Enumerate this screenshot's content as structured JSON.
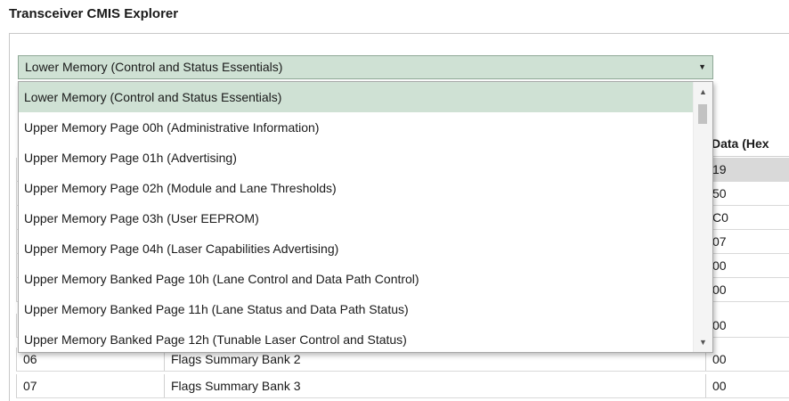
{
  "app": {
    "title": "Transceiver CMIS Explorer"
  },
  "memory_select": {
    "selected": "Lower Memory (Control and Status Essentials)",
    "options": [
      "Lower Memory (Control and Status Essentials)",
      "Upper Memory Page 00h (Administrative Information)",
      "Upper Memory Page 01h (Advertising)",
      "Upper Memory Page 02h (Module and Lane Thresholds)",
      "Upper Memory Page 03h (User EEPROM)",
      "Upper Memory Page 04h (Laser Capabilities Advertising)",
      "Upper Memory Banked Page 10h (Lane Control and Data Path Control)",
      "Upper Memory Banked Page 11h (Lane Status and Data Path Status)",
      "Upper Memory Banked Page 12h (Tunable Laser Control and Status)"
    ]
  },
  "grid": {
    "data_header": "Data (Hex",
    "rows": [
      {
        "offset": "",
        "name": "",
        "data": "19"
      },
      {
        "offset": "",
        "name": "",
        "data": "50"
      },
      {
        "offset": "",
        "name": "",
        "data": "C0"
      },
      {
        "offset": "",
        "name": "",
        "data": "07"
      },
      {
        "offset": "",
        "name": "",
        "data": "00"
      },
      {
        "offset": "",
        "name": "",
        "data": "00"
      },
      {
        "offset": "06",
        "name": "Flags Summary Bank 2",
        "data": "00"
      },
      {
        "offset": "07",
        "name": "Flags Summary Bank 3",
        "data": "00"
      }
    ]
  },
  "colors": {
    "accent": "#cfe1d4",
    "selected_row": "#d9d9d9"
  },
  "icons": {
    "combo_arrow": "chevron-down-icon",
    "scroll_up": "scroll-up-arrow-icon",
    "scroll_down": "scroll-down-arrow-icon"
  }
}
